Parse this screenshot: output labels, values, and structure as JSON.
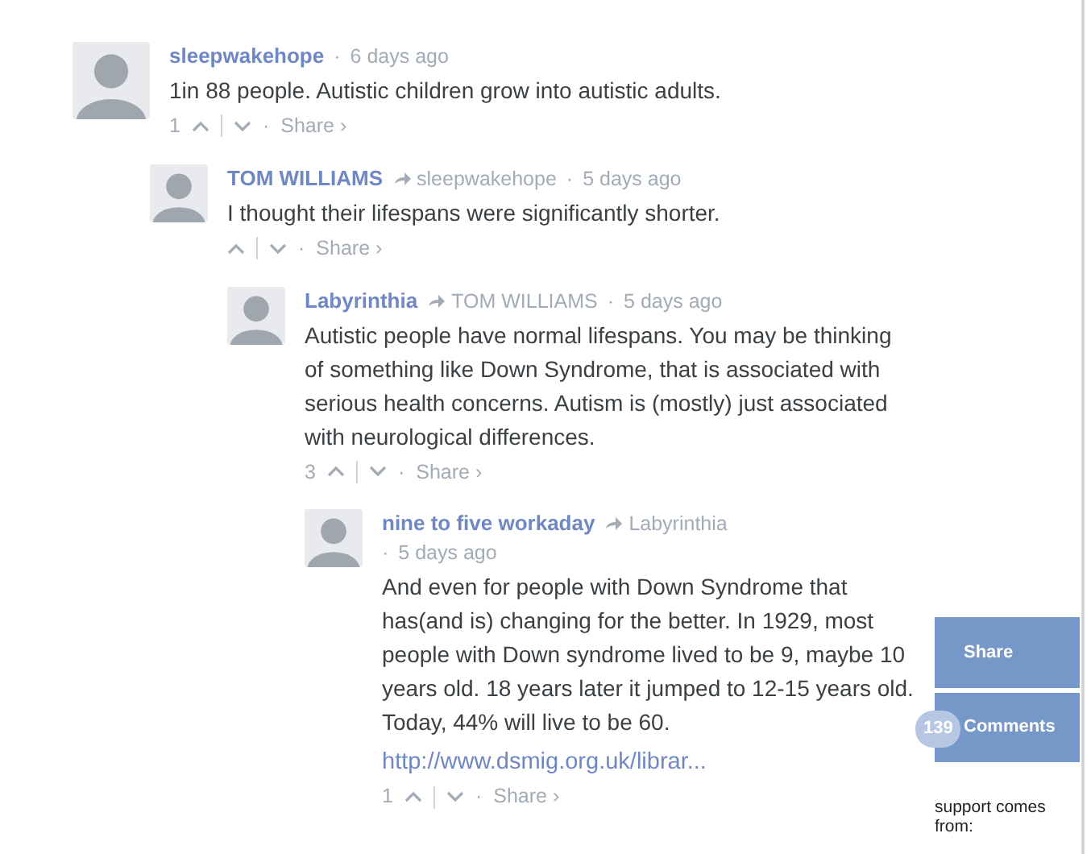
{
  "comments": [
    {
      "author": "sleepwakehope",
      "sep": "·",
      "time": "6 days ago",
      "vote_sep": "·",
      "text": "1in 88 people. Autistic children grow into autistic adults.",
      "votes": "1",
      "share": "Share ›",
      "children": [
        {
          "author": "TOM WILLIAMS",
          "reply_to": "sleepwakehope",
          "sep": "·",
          "time": "5 days ago",
          "vote_sep": "·",
          "text": "I thought their lifespans were significantly shorter.",
          "share": "Share ›",
          "children": [
            {
              "author": "Labyrinthia",
              "reply_to": "TOM WILLIAMS",
              "sep": "·",
              "time": "5 days ago",
              "vote_sep": "·",
              "text": "Autistic people have normal lifespans. You may be thinking of something like Down Syndrome, that is associated with serious health concerns. Autism is (mostly) just associated with neurological differences.",
              "votes": "3",
              "share": "Share ›",
              "children": [
                {
                  "author": "nine to five workaday",
                  "reply_to": "Labyrinthia",
                  "sep": "·",
                  "time": "5 days ago",
                  "vote_sep": "·",
                  "text": "And even for people with Down Syndrome that has(and is) changing for the better. In 1929, most people with Down syndrome lived to be 9, maybe 10 years old. 18 years later it jumped to 12-15 years old. Today, 44% will live to be 60.",
                  "link": "http://www.dsmig.org.uk/librar...",
                  "votes": "1",
                  "share": "Share ›"
                }
              ]
            }
          ]
        }
      ]
    }
  ],
  "side": {
    "share": "Share",
    "count": "139",
    "comments": "Comments",
    "support": "support comes from:"
  }
}
